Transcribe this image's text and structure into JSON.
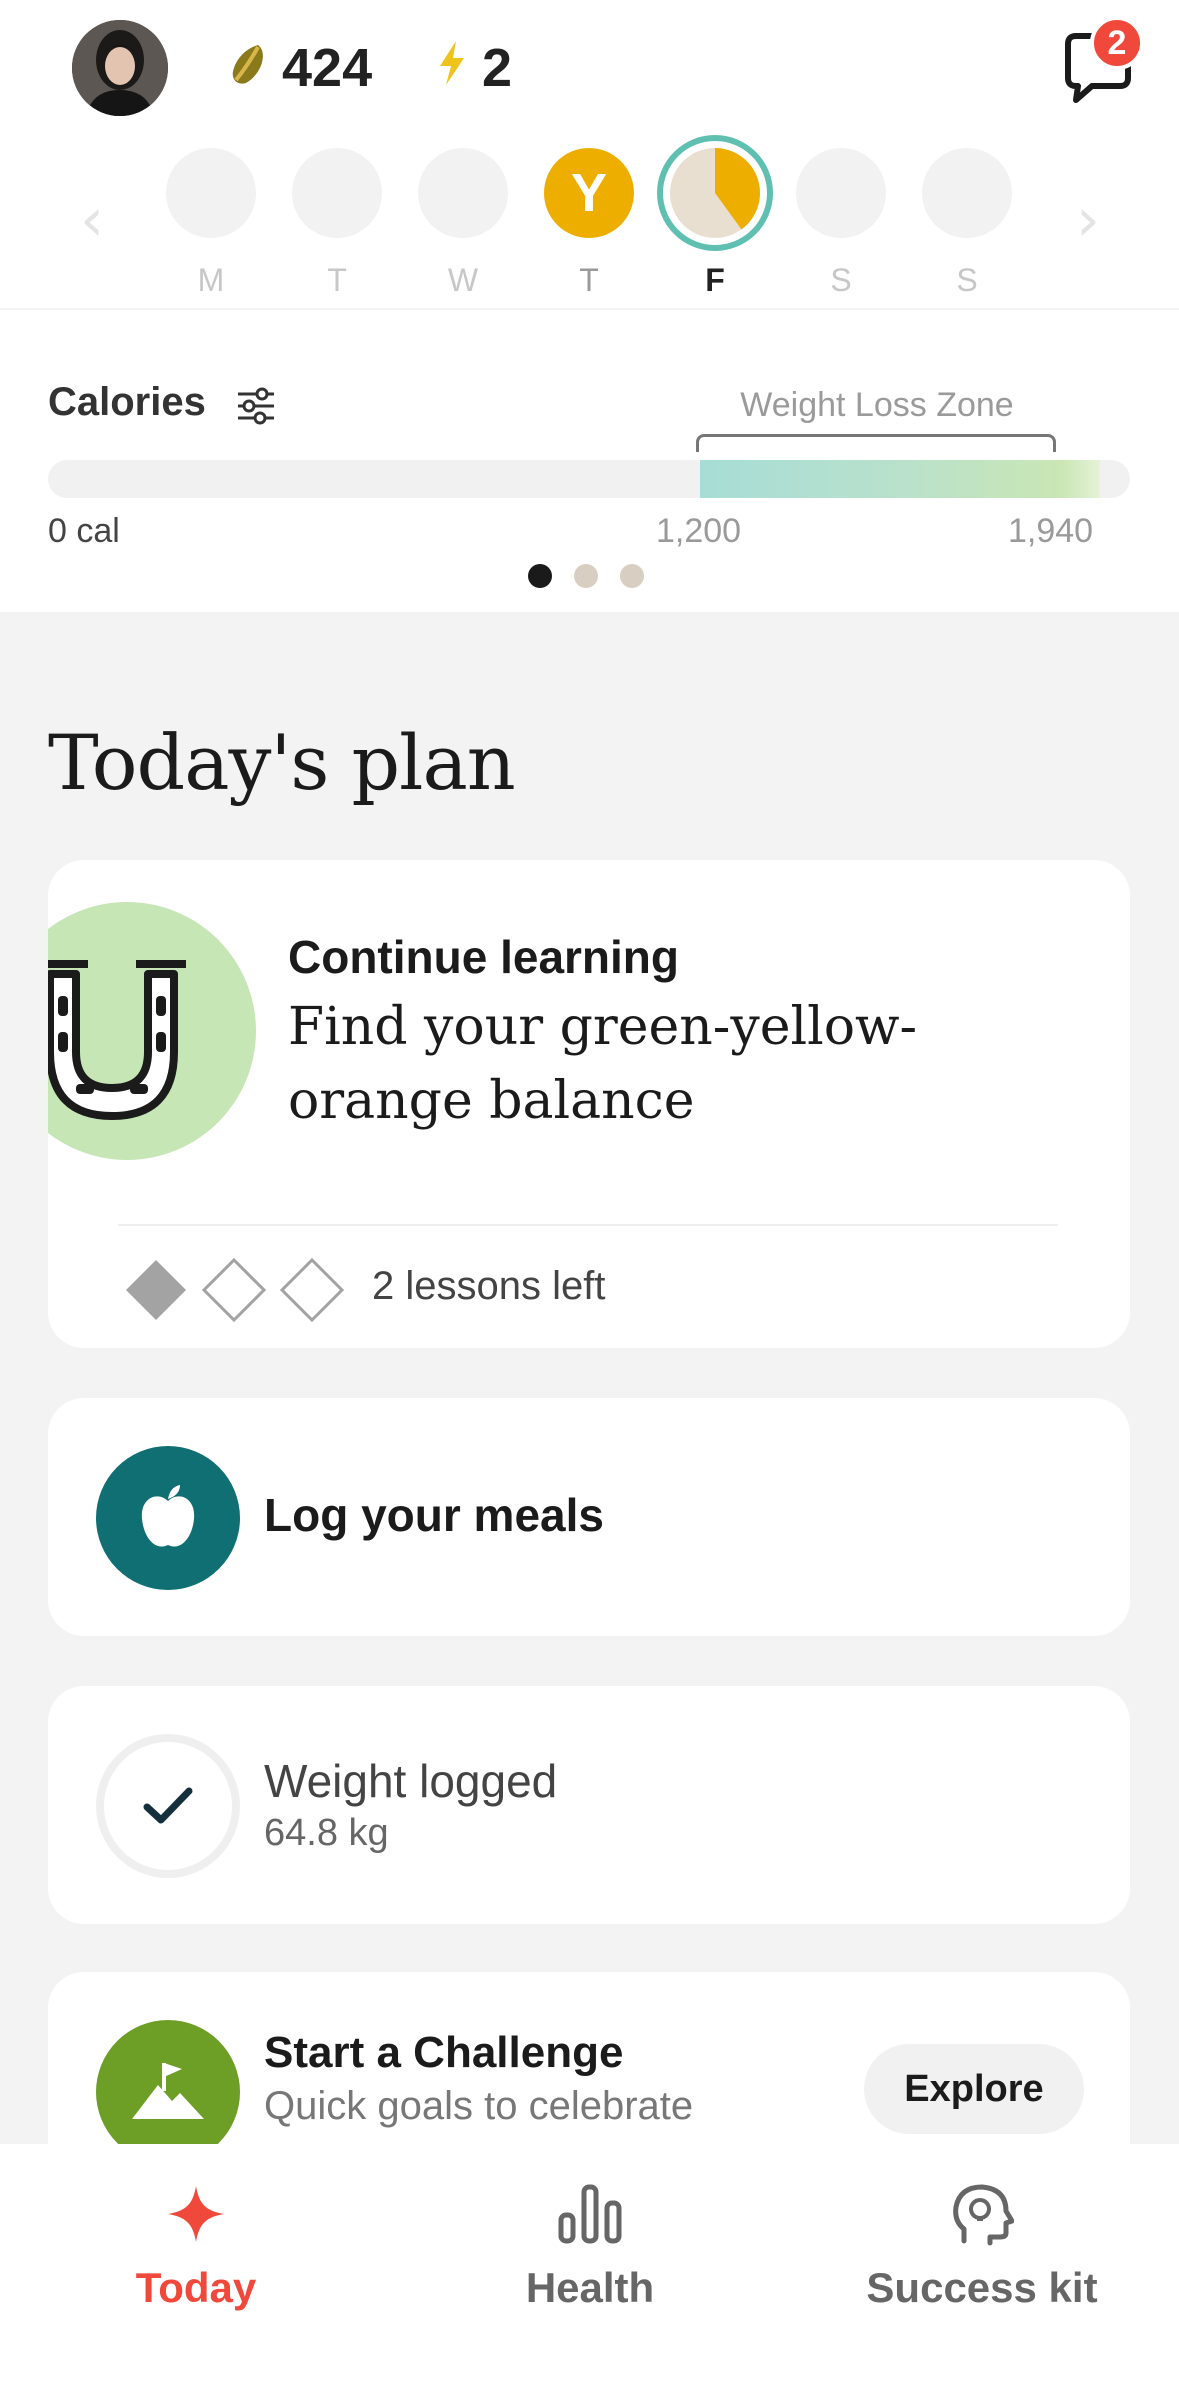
{
  "header": {
    "seeds_count": "424",
    "streak_count": "2",
    "chat_badge": "2",
    "icons": {
      "seed": "seed-icon",
      "streak": "lightning-icon",
      "chat": "chat-bubble-icon"
    }
  },
  "week": {
    "days": [
      {
        "label": "M"
      },
      {
        "label": "T"
      },
      {
        "label": "W"
      },
      {
        "label": "T",
        "marker": "Y"
      },
      {
        "label": "F",
        "active": true
      },
      {
        "label": "S"
      },
      {
        "label": "S"
      }
    ],
    "today_progress": 0.4,
    "colors": {
      "accent": "#eeae00",
      "ring": "#5fc0b2"
    }
  },
  "calories": {
    "title": "Calories",
    "zone_label": "Weight Loss Zone",
    "axis_min": "0 cal",
    "axis_mid": "1,200",
    "axis_max": "1,940",
    "page_count": 3,
    "page_active": 1
  },
  "plan": {
    "title": "Today's plan",
    "learn": {
      "kicker": "Continue learning",
      "title": "Find your green-yellow-orange balance",
      "lessons_left": "2 lessons left",
      "lessons_done": 1,
      "lessons_total": 3
    },
    "meals": {
      "label": "Log your meals",
      "icon": "apple-icon",
      "color": "#0f6f73"
    },
    "weight": {
      "title": "Weight logged",
      "value": "64.8 kg",
      "icon": "check-icon"
    },
    "challenge": {
      "title": "Start a Challenge",
      "subtitle": "Quick goals to celebrate",
      "button": "Explore",
      "icon": "flag-mountain-icon",
      "color": "#6d9e26"
    }
  },
  "nav": {
    "items": [
      {
        "label": "Today",
        "icon": "sparkle-icon",
        "active": true
      },
      {
        "label": "Health",
        "icon": "bar-chart-icon"
      },
      {
        "label": "Success kit",
        "icon": "head-idea-icon"
      }
    ],
    "active_color": "#f0483a"
  }
}
